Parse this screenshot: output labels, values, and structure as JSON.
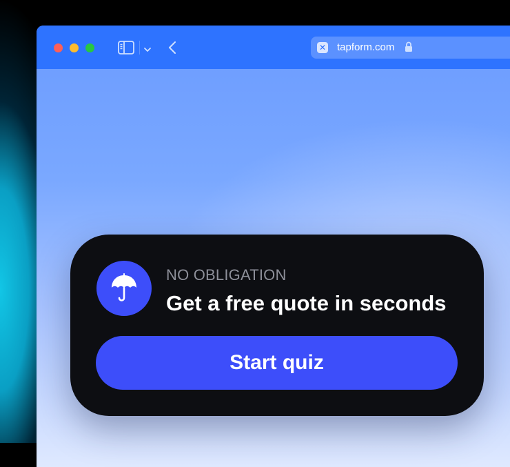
{
  "browser": {
    "url": "tapform.com",
    "icons": {
      "sidebar": "sidebar-toggle-icon",
      "chevron": "chevron-down-icon",
      "back": "chevron-left-icon",
      "favicon": "tab-close-icon",
      "lock": "lock-icon"
    }
  },
  "card": {
    "eyebrow": "NO OBLIGATION",
    "headline": "Get a free quote in seconds",
    "button_label": "Start quiz",
    "icon": "umbrella-icon"
  },
  "colors": {
    "toolbar": "#2e73ff",
    "card_bg": "#0d0e12",
    "accent": "#3d4efa",
    "eyebrow": "#8d8f99"
  }
}
